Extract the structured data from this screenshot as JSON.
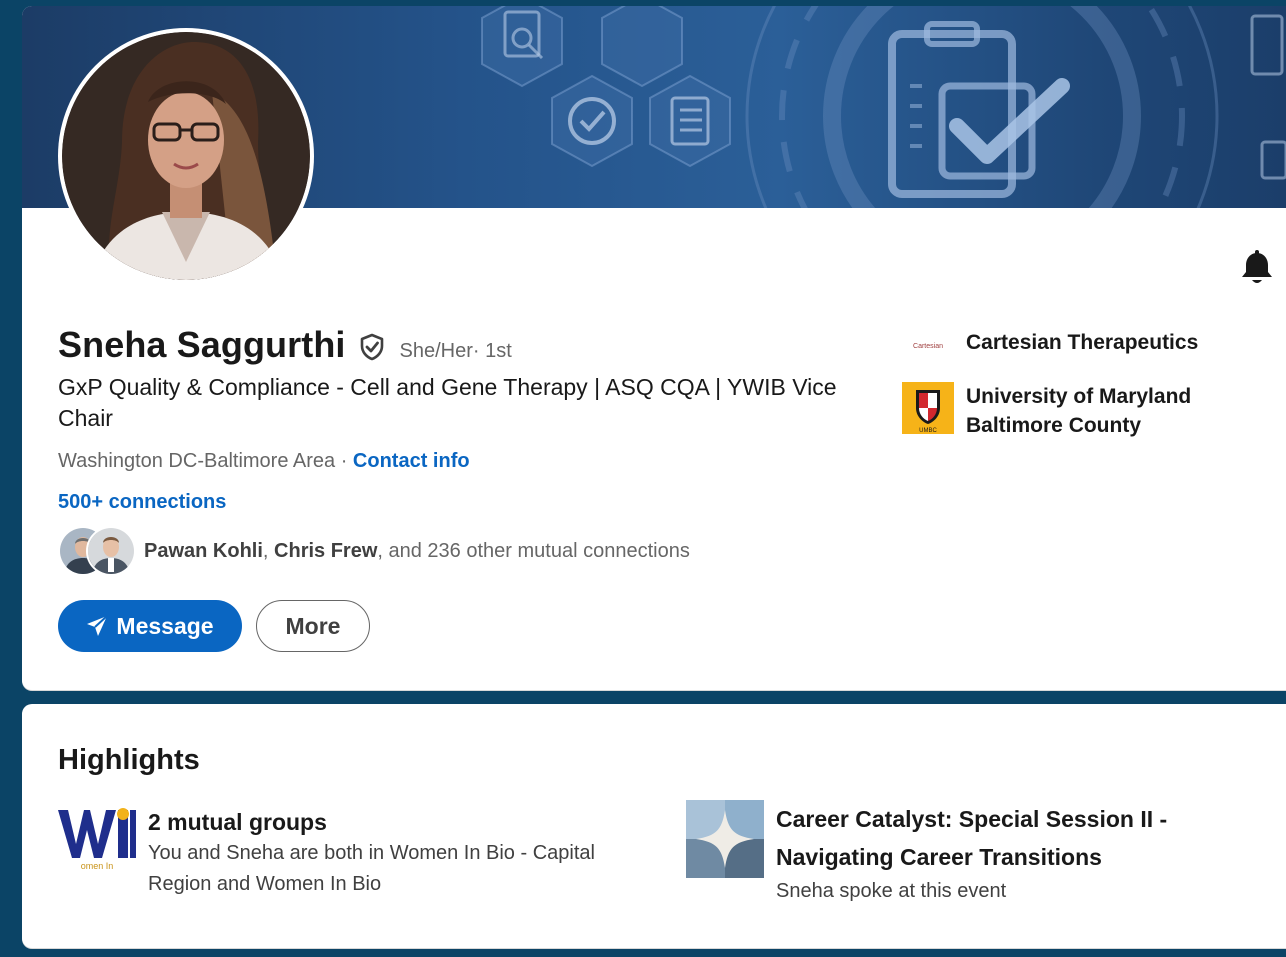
{
  "profile": {
    "name": "Sneha Saggurthi",
    "pronouns": "She/Her",
    "degree": " · 1st",
    "headline": "GxP Quality & Compliance - Cell and Gene Therapy | ASQ CQA | YWIB Vice Chair",
    "location": "Washington DC-Baltimore Area · ",
    "contact_info_label": "Contact info",
    "connections_label": "500+ connections",
    "mutual": {
      "name1": "Pawan Kohli",
      "sep1": ", ",
      "name2": "Chris Frew",
      "rest": ", and 236 other mutual connections"
    }
  },
  "actions": {
    "message_label": "Message",
    "more_label": "More"
  },
  "organizations": [
    {
      "name": "Cartesian Therapeutics",
      "logo_text": "Cartesian"
    },
    {
      "name": "University of Maryland Baltimore County",
      "logo_text": "UMBC"
    }
  ],
  "highlights": {
    "title": "Highlights",
    "groups": {
      "heading": "2 mutual groups",
      "description": "You and Sneha are both in Women In Bio - Capital Region and Women In Bio",
      "logo_text": "omen In"
    },
    "event": {
      "heading": "Career Catalyst: Special Session II - Navigating Career Transitions",
      "description": "Sneha spoke at this event"
    }
  },
  "colors": {
    "accent": "#0a66c2",
    "background": "#0b4466",
    "banner": "#24538a"
  },
  "icons": {
    "notification": "bell-icon",
    "verified": "verified-shield-icon",
    "message": "paper-plane-icon"
  }
}
